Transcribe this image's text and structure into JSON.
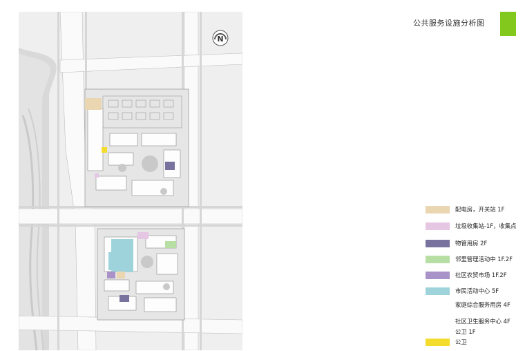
{
  "title": "公共服务设施分析图",
  "colors": {
    "accent": "#83c81d",
    "electric": "#ead6b1",
    "garbage": "#e5c6e3",
    "property": "#77739e",
    "neighborhood": "#b7dfa4",
    "market": "#a992c7",
    "civic": "#9fd3dc",
    "toilet": "#f4dc2c"
  },
  "compass": {
    "label": "N"
  },
  "legend": [
    {
      "label": "配电房，开关站  1F",
      "color": "#ead6b1"
    },
    {
      "label": "垃圾收集站-1F，收集点",
      "color": "#e5c6e3"
    },
    {
      "label": "物管用房  2F",
      "color": "#77739e"
    },
    {
      "label": "邻里管理活动中 1F.2F",
      "color": "#b7dfa4"
    },
    {
      "label": "社区农贸市场  1F.2F",
      "color": "#a992c7"
    },
    {
      "label": "市民活动中心 5F",
      "color": "#9fd3dc"
    },
    {
      "label": "家庭综合服务用房 4F",
      "color": null
    },
    {
      "label": "社区卫生服务中心 4F",
      "color": null
    },
    {
      "label": "公卫 1F",
      "color": null
    },
    {
      "label": "公卫",
      "color": "#f4dc2c"
    }
  ]
}
